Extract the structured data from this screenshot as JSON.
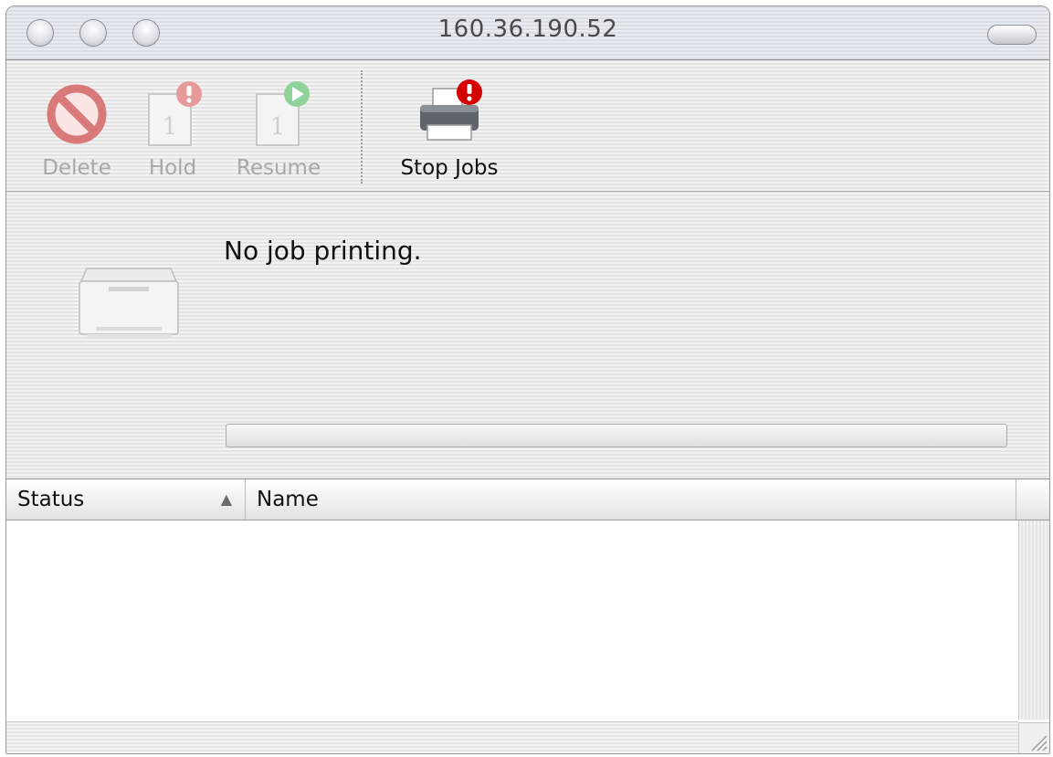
{
  "window": {
    "title": "160.36.190.52"
  },
  "toolbar": {
    "delete_label": "Delete",
    "hold_label": "Hold",
    "resume_label": "Resume",
    "stop_jobs_label": "Stop Jobs"
  },
  "status": {
    "message": "No job printing.",
    "progress_fraction": 0
  },
  "table": {
    "columns": [
      "Status",
      "Name"
    ],
    "sort_indicator": "▲",
    "rows": []
  },
  "icons": {
    "delete": "no-entry-icon",
    "hold": "document-alert-icon",
    "resume": "document-play-icon",
    "stop_jobs": "printer-alert-icon",
    "printer": "printer-icon"
  },
  "colors": {
    "alert_red": "#d40000",
    "play_green": "#3cb54a",
    "delete_red": "#d97a7a",
    "disabled_text": "#a8a8a8"
  }
}
